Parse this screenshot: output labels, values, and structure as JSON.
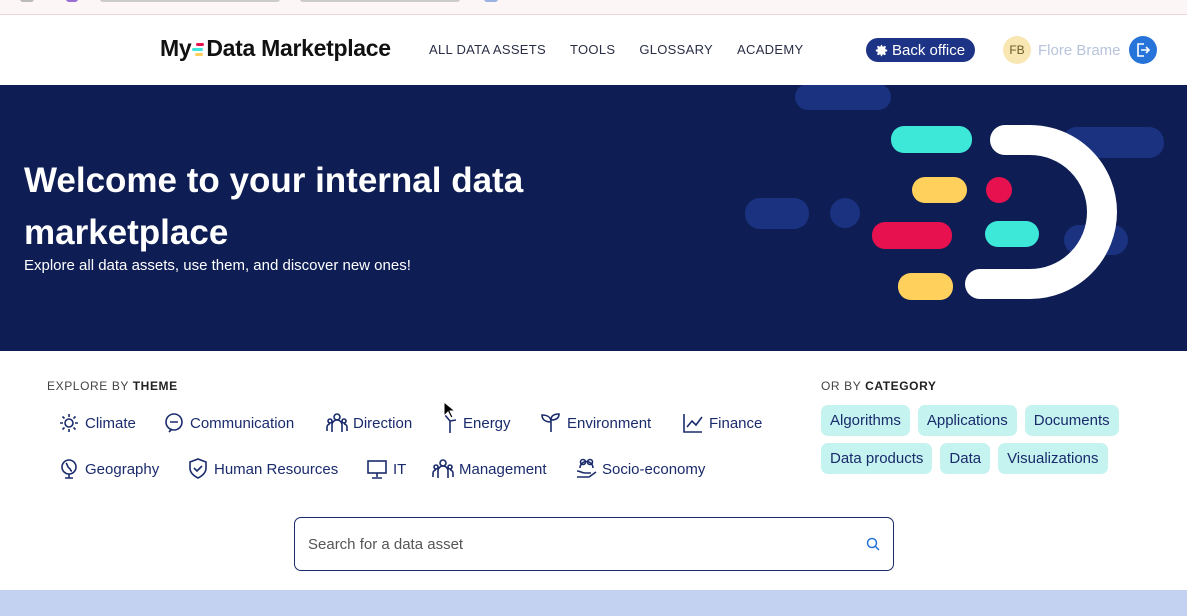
{
  "header": {
    "logo_pre": "My",
    "logo_post": "Data Marketplace",
    "nav": [
      "ALL DATA ASSETS",
      "TOOLS",
      "GLOSSARY",
      "ACADEMY"
    ],
    "back_office_label": "Back office",
    "user_initials": "FB",
    "user_name": "Flore Brame"
  },
  "hero": {
    "title": "Welcome to your internal data marketplace",
    "subtitle": "Explore all data assets, use them, and discover new ones!"
  },
  "explore": {
    "prefix": "EXPLORE BY ",
    "strong": "THEME",
    "themes": [
      "Climate",
      "Communication",
      "Direction",
      "Energy",
      "Environment",
      "Finance",
      "Geography",
      "Human Resources",
      "IT",
      "Management",
      "Socio-economy"
    ]
  },
  "category": {
    "prefix": "OR BY ",
    "strong": "CATEGORY",
    "chips": [
      "Algorithms",
      "Applications",
      "Documents",
      "Data products",
      "Data",
      "Visualizations"
    ]
  },
  "search": {
    "placeholder": "Search for a data asset"
  },
  "colors": {
    "navy": "#0e1e54",
    "teal": "#3ee8d9",
    "yellow": "#ffd15c",
    "red": "#e8114f",
    "chip": "#c5f3ef",
    "accent_blue": "#2674d9"
  }
}
